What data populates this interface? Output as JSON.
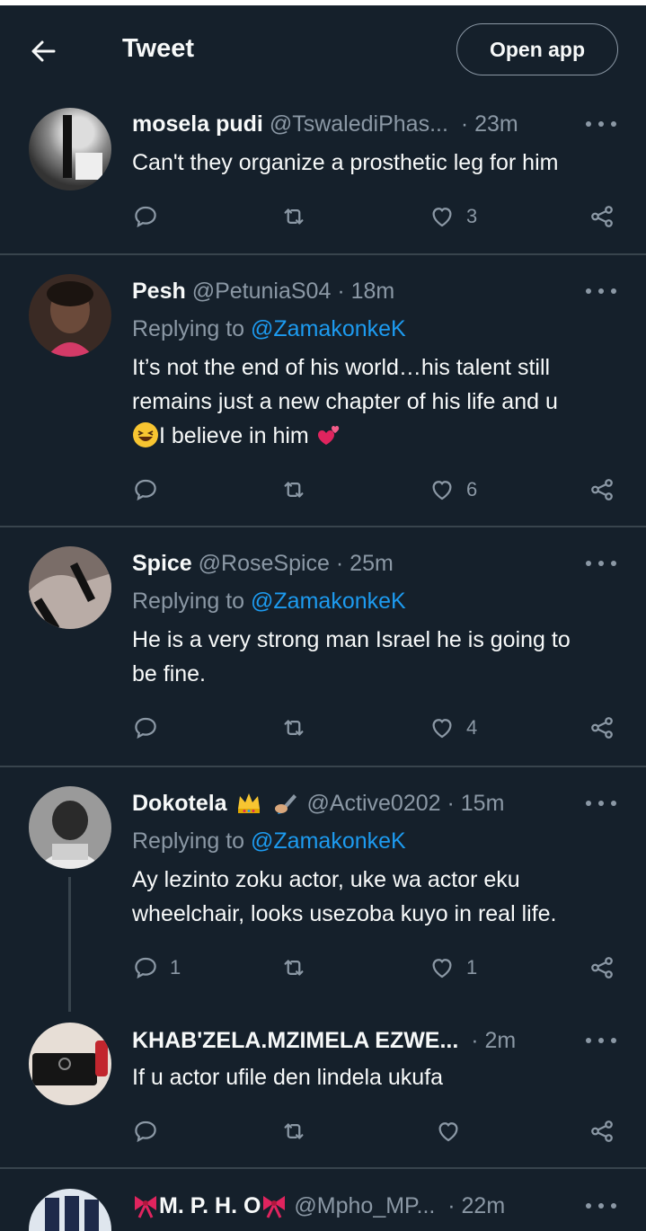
{
  "header": {
    "title": "Tweet",
    "open_app_label": "Open app"
  },
  "tweets": [
    {
      "name": "mosela pudi",
      "handle": "@TswalediPhas...",
      "time": "· 23m",
      "text": "Can't they organize a prosthetic leg for him",
      "reply_count": "",
      "like_count": "3"
    },
    {
      "name": "Pesh",
      "handle": "@PetuniaS04",
      "time": "· 18m",
      "replying_label": "Replying to",
      "replying_to": "@ZamakonkeK",
      "text_line1": "It’s  not the end of his world…his talent still",
      "text_line2": "remains just a new chapter of his life and u",
      "text_line3": "I believe in him",
      "reply_count": "",
      "like_count": "6"
    },
    {
      "name": "Spice",
      "handle": "@RoseSpice",
      "time": "· 25m",
      "replying_label": "Replying to",
      "replying_to": "@ZamakonkeK",
      "text_line1": "He is a very strong man Israel he is going to",
      "text_line2": "be fine.",
      "reply_count": "",
      "like_count": "4"
    },
    {
      "name": "Dokotela",
      "handle": "@Active0202",
      "time": "· 15m",
      "replying_label": "Replying to",
      "replying_to": "@ZamakonkeK",
      "text_line1": "Ay lezinto zoku actor, uke wa actor eku",
      "text_line2": "wheelchair, looks usezoba kuyo in real life.",
      "reply_count": "1",
      "like_count": "1"
    },
    {
      "name": "KHAB'ZELA.MZIMELA EZWE...",
      "handle": "",
      "time": "· 2m",
      "text": "If u actor ufile den lindela ukufa",
      "reply_count": "",
      "like_count": ""
    },
    {
      "name": "M. P. H. O",
      "handle": "@Mpho_MP...",
      "time": "· 22m"
    }
  ],
  "colors": {
    "background": "#15202b",
    "secondary_text": "#8b98a5",
    "link": "#1d9bf0",
    "divider": "#38444d"
  },
  "icons": [
    "back-arrow-icon",
    "more-icon",
    "reply-icon",
    "retweet-icon",
    "like-icon",
    "share-icon",
    "crown-icon",
    "pen-icon",
    "grin-emoji",
    "hearts-emoji",
    "ribbon-icon"
  ]
}
